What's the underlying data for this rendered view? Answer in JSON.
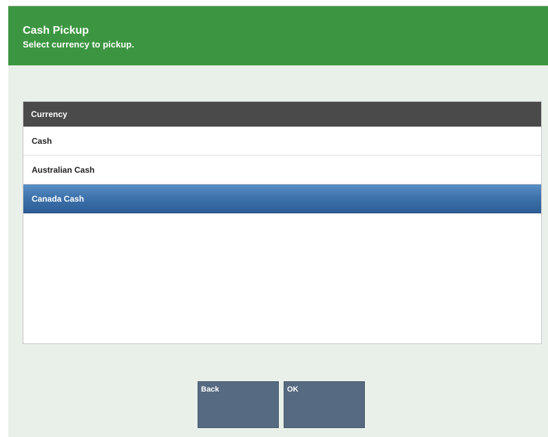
{
  "header": {
    "title": "Cash Pickup",
    "subtitle": "Select currency to pickup."
  },
  "table": {
    "column_header": "Currency",
    "rows": [
      {
        "label": "Cash",
        "selected": false
      },
      {
        "label": "Australian Cash",
        "selected": false
      },
      {
        "label": "Canada Cash",
        "selected": true
      }
    ]
  },
  "buttons": {
    "back_label": "Back",
    "ok_label": "OK"
  },
  "colors": {
    "header_bg": "#3c9641",
    "table_header_bg": "#4a4a4a",
    "selected_row_bg": "#3e73ad",
    "button_bg": "#566a81",
    "page_bg": "#e9f0e9"
  }
}
